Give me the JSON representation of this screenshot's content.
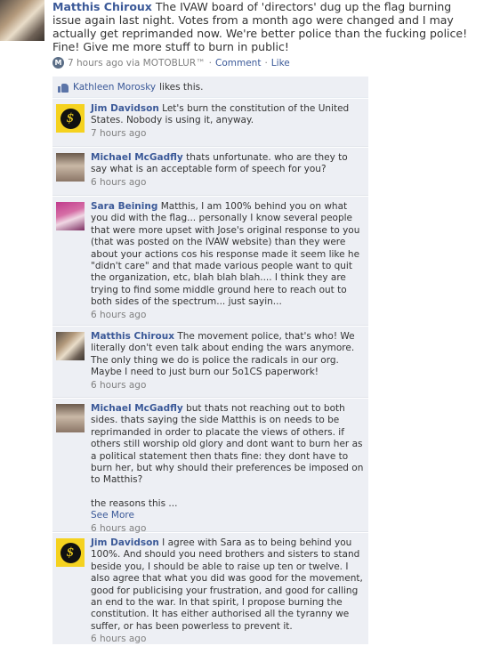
{
  "post": {
    "author": "Matthis Chiroux",
    "text": "The IVAW board of 'directors' dug up the flag burning issue again last night. Votes from a month ago were changed and I may actually get reprimanded now. We're better police than the fucking police! Fine! Give me more stuff to burn in public!",
    "time": "7 hours ago via MOTOBLUR™",
    "separator": "·",
    "comment_label": "Comment",
    "like_label": "Like"
  },
  "likes": {
    "name": "Kathleen Morosky",
    "suffix": "likes this."
  },
  "comments": [
    {
      "author": "Jim Davidson",
      "text": "Let's burn the constitution of the United States. Nobody is using it, anyway.",
      "time": "7 hours ago"
    },
    {
      "author": "Michael McGadfly",
      "text": "thats unfortunate. who are they to say what is an acceptable form of speech for you?",
      "time": "6 hours ago"
    },
    {
      "author": "Sara Beining",
      "text": "Matthis, I am 100% behind you on what you did with the flag... personally I know several people that were more upset with Jose's original response to you (that was posted on the IVAW website) than they were about your actions cos his response made it seem like he \"didn't care\" and that made various people want to quit the organization, etc, blah blah blah.... I think they are trying to find some middle ground here to reach out to both sides of the spectrum... just sayin...",
      "time": "6 hours ago"
    },
    {
      "author": "Matthis Chiroux",
      "text": "The movement police, that's who! We literally don't even talk about ending the wars anymore. The only thing we do is police the radicals in our org. Maybe I need to just burn our 5o1CS paperwork!",
      "time": "6 hours ago"
    },
    {
      "author": "Michael McGadfly",
      "text": "but thats not reaching out to both sides. thats saying the side Matthis is on needs to be reprimanded in order to placate the views of others. if others still worship old glory and dont want to burn her as a political statement then thats fine: they dont have to burn her, but why should their preferences be imposed on to Matthis?",
      "text2": "the reasons this ...",
      "see_more": "See More",
      "time": "6 hours ago"
    },
    {
      "author": "Jim Davidson",
      "text": "I agree with Sara as to being behind you 100%. And should you need brothers and sisters to stand beside you, I should be able to raise up ten or twelve. I also agree that what you did was good for the movement, good for publicising your frustration, and good for calling an end to the war. In that spirit, I propose burning the constitution. It has either authorised all the tyranny we suffer, or has been powerless to prevent it.",
      "time": "6 hours ago"
    }
  ]
}
